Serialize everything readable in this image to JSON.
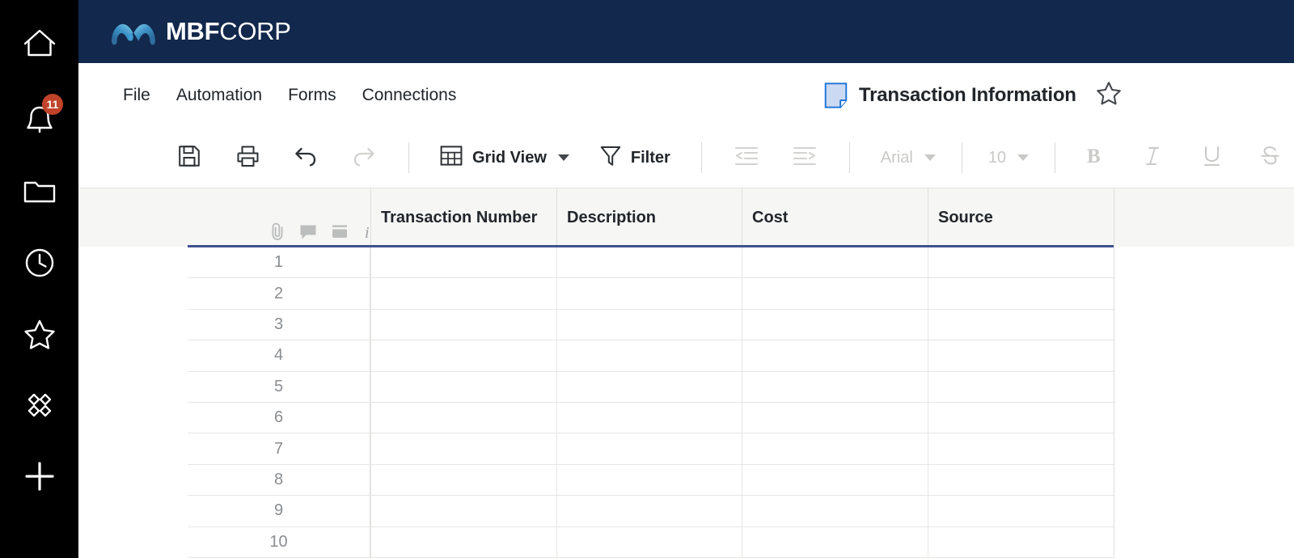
{
  "brand": {
    "name_bold": "MBF",
    "name_light": "CORP",
    "logo_icon": "mbf-wave-logo-icon",
    "bar_color": "#12284c",
    "logo_gradient_from": "#7fd4f2",
    "logo_gradient_to": "#1f4e79"
  },
  "rail": {
    "items": [
      {
        "icon": "home-icon",
        "name": "home"
      },
      {
        "icon": "bell-icon",
        "name": "notifications",
        "badge": "11",
        "badge_color": "#c0432a"
      },
      {
        "icon": "folder-icon",
        "name": "browse"
      },
      {
        "icon": "clock-icon",
        "name": "recents"
      },
      {
        "icon": "star-icon",
        "name": "favorites"
      },
      {
        "icon": "diamond-grid-icon",
        "name": "workapps"
      },
      {
        "icon": "plus-icon",
        "name": "create"
      }
    ]
  },
  "menu": {
    "items": [
      {
        "label": "File"
      },
      {
        "label": "Automation"
      },
      {
        "label": "Forms"
      },
      {
        "label": "Connections"
      }
    ]
  },
  "document": {
    "icon": "sheet-icon",
    "title": "Transaction Information",
    "favorite_icon": "star-outline-icon",
    "favorited": false
  },
  "toolbar": {
    "save": {
      "label": "Save",
      "icon": "save-icon",
      "disabled": false
    },
    "print": {
      "label": "Print",
      "icon": "print-icon",
      "disabled": false
    },
    "undo": {
      "label": "Undo",
      "icon": "undo-icon",
      "disabled": false
    },
    "redo": {
      "label": "Redo",
      "icon": "redo-icon",
      "disabled": true
    },
    "view": {
      "label": "Grid View",
      "icon": "grid-view-icon"
    },
    "filter": {
      "label": "Filter",
      "icon": "filter-icon"
    },
    "outdent": {
      "label": "Decrease indent",
      "icon": "outdent-icon",
      "disabled": true
    },
    "indent": {
      "label": "Increase indent",
      "icon": "indent-icon",
      "disabled": true
    },
    "font_family": {
      "value": "Arial",
      "disabled": true
    },
    "font_size": {
      "value": "10",
      "disabled": true
    },
    "bold": {
      "label": "B",
      "icon": "bold-icon",
      "disabled": true
    },
    "italic": {
      "label": "I",
      "icon": "italic-icon",
      "disabled": true
    },
    "underline": {
      "label": "U",
      "icon": "underline-icon",
      "disabled": true
    },
    "strikethrough": {
      "label": "S",
      "icon": "strikethrough-icon",
      "disabled": true
    },
    "fill_color": {
      "icon": "fill-color-icon",
      "disabled": true
    },
    "text_color": {
      "icon": "text-color-icon",
      "disabled": true
    },
    "align": {
      "icon": "align-icon",
      "disabled": true
    }
  },
  "grid": {
    "row_meta_icons": [
      {
        "icon": "attachment-icon",
        "name": "attachments"
      },
      {
        "icon": "comment-icon",
        "name": "comments"
      },
      {
        "icon": "row-actions-icon",
        "name": "row-actions"
      },
      {
        "icon": "info-icon",
        "name": "proof-info"
      }
    ],
    "columns": [
      {
        "label": "Transaction Number"
      },
      {
        "label": "Description"
      },
      {
        "label": "Cost"
      },
      {
        "label": "Source"
      }
    ],
    "header_underline_color": "#3f528f",
    "rows": [
      {
        "num": "1",
        "cells": [
          "",
          "",
          "",
          ""
        ]
      },
      {
        "num": "2",
        "cells": [
          "",
          "",
          "",
          ""
        ]
      },
      {
        "num": "3",
        "cells": [
          "",
          "",
          "",
          ""
        ]
      },
      {
        "num": "4",
        "cells": [
          "",
          "",
          "",
          ""
        ]
      },
      {
        "num": "5",
        "cells": [
          "",
          "",
          "",
          ""
        ]
      },
      {
        "num": "6",
        "cells": [
          "",
          "",
          "",
          ""
        ]
      },
      {
        "num": "7",
        "cells": [
          "",
          "",
          "",
          ""
        ]
      },
      {
        "num": "8",
        "cells": [
          "",
          "",
          "",
          ""
        ]
      },
      {
        "num": "9",
        "cells": [
          "",
          "",
          "",
          ""
        ]
      },
      {
        "num": "10",
        "cells": [
          "",
          "",
          "",
          ""
        ]
      }
    ]
  }
}
